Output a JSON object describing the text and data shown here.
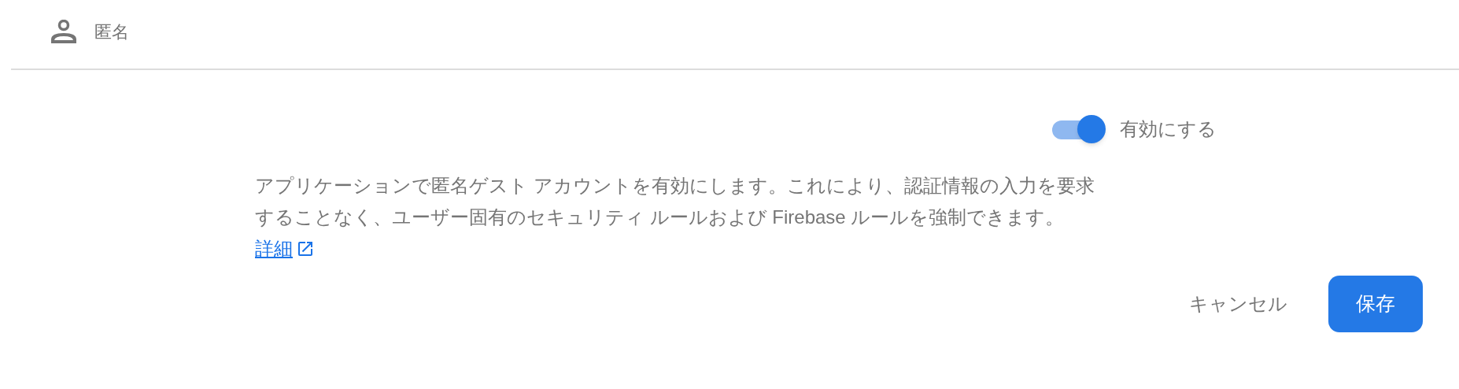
{
  "header": {
    "title": "匿名"
  },
  "toggle": {
    "on": true,
    "label": "有効にする"
  },
  "description": {
    "lines": [
      "アプリケーションで匿名ゲスト アカウントを有効にします。これにより、認証情報の入力を要求",
      "することなく、ユーザー固有のセキュリティ ルールおよび Firebase ルールを強制できます。"
    ],
    "link": "詳細"
  },
  "buttons": {
    "cancel": "キャンセル",
    "save": "保存"
  }
}
